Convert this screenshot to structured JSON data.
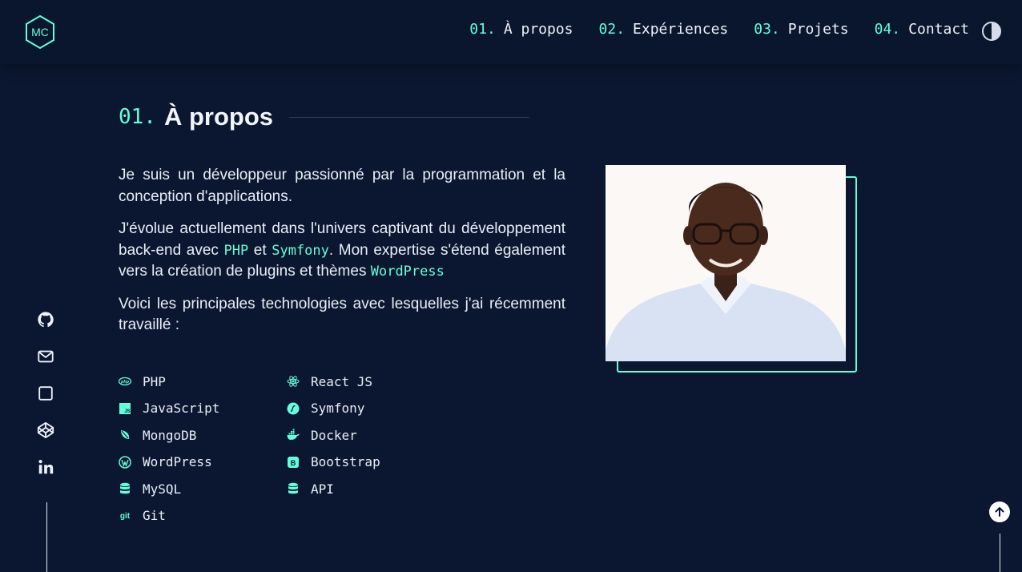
{
  "header": {
    "logo_text": "MC",
    "nav": [
      {
        "num": "01.",
        "label": "À propos"
      },
      {
        "num": "02.",
        "label": "Expériences"
      },
      {
        "num": "03.",
        "label": "Projets"
      },
      {
        "num": "04.",
        "label": "Contact"
      }
    ],
    "theme_icon": "half-circle-contrast-icon"
  },
  "colors": {
    "accent": "#64ffda",
    "background": "#0b1730",
    "text": "#e6ecf5"
  },
  "section": {
    "num": "01.",
    "title": "À propos"
  },
  "about": {
    "p1": "Je suis un développeur passionné par la programmation et la conception d'applications.",
    "p2_part1": "J'évolue actuellement dans l'univers captivant du développement back-end avec ",
    "p2_php": "PHP",
    "p2_part2": " et ",
    "p2_symfony": "Symfony",
    "p2_part3": ". Mon expertise s'étend également vers la création de plugins et thèmes ",
    "p2_wordpress": "WordPress",
    "p3": "Voici les principales technologies avec lesquelles j'ai récemment travaillé :"
  },
  "technologies": [
    {
      "label": "PHP",
      "icon": "php-icon"
    },
    {
      "label": "React JS",
      "icon": "react-icon"
    },
    {
      "label": "JavaScript",
      "icon": "javascript-icon"
    },
    {
      "label": "Symfony",
      "icon": "symfony-icon"
    },
    {
      "label": "MongoDB",
      "icon": "mongodb-icon"
    },
    {
      "label": "Docker",
      "icon": "docker-icon"
    },
    {
      "label": "WordPress",
      "icon": "wordpress-icon"
    },
    {
      "label": "Bootstrap",
      "icon": "bootstrap-icon"
    },
    {
      "label": "MySQL",
      "icon": "database-icon"
    },
    {
      "label": "API",
      "icon": "database-icon"
    },
    {
      "label": "Git",
      "icon": "git-icon",
      "icon_text": "git"
    }
  ],
  "social": [
    "github-icon",
    "mail-icon",
    "square-icon",
    "codepen-icon",
    "linkedin-icon"
  ],
  "scroll_top_icon": "arrow-up-icon",
  "photo_icon": "profile-photo"
}
